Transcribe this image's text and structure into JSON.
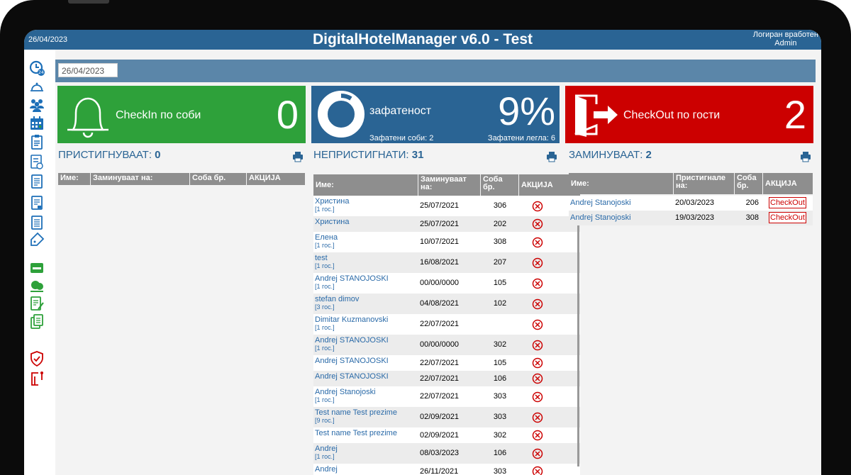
{
  "header": {
    "date": "26/04/2023",
    "title": "DigitalHotelManager v6.0 - Test",
    "user_line1": "Логиран вработен",
    "user_line2": "Admin"
  },
  "filter": {
    "date_value": "26/04/2023"
  },
  "tiles": {
    "checkin": {
      "label": "CheckIn по соби",
      "value": "0"
    },
    "occupancy": {
      "label": "зафатеност",
      "value": "9%",
      "rooms": "Зафатени соби: 2",
      "beds": "Зафатени легла: 6",
      "fraction": 0.09
    },
    "checkout": {
      "label": "CheckOut по гости",
      "value": "2"
    }
  },
  "arriving": {
    "title": "ПРИСТИГНУВААТ: ",
    "count": "0",
    "headers": [
      "Име:",
      "Заминуваат на:",
      "Соба бр.",
      "АКЦИЈА"
    ]
  },
  "not_arrived": {
    "title": "НЕПРИСТИГНАТИ: ",
    "count": "31",
    "headers": [
      "Име:",
      "Заминуваат на:",
      "Соба бр.",
      "АКЦИЈА"
    ],
    "rows": [
      {
        "name": "Христина",
        "guests": "[1 гос.]",
        "date": "25/07/2021",
        "room": "306"
      },
      {
        "name": "Христина",
        "guests": "",
        "date": "25/07/2021",
        "room": "202"
      },
      {
        "name": "Елена",
        "guests": "[1 гос.]",
        "date": "10/07/2021",
        "room": "308"
      },
      {
        "name": "test",
        "guests": "[1 гос.]",
        "date": "16/08/2021",
        "room": "207"
      },
      {
        "name": "Andrej STANOJOSKI",
        "guests": "[1 гос.]",
        "date": "00/00/0000",
        "room": "105"
      },
      {
        "name": "stefan dimov",
        "guests": "[3 гос.]",
        "date": "04/08/2021",
        "room": "102"
      },
      {
        "name": "Dimitar Kuzmanovski",
        "guests": "[1 гос.]",
        "date": "22/07/2021",
        "room": ""
      },
      {
        "name": "Andrej STANOJOSKI",
        "guests": "[1 гос.]",
        "date": "00/00/0000",
        "room": "302"
      },
      {
        "name": "Andrej STANOJOSKI",
        "guests": "",
        "date": "22/07/2021",
        "room": "105"
      },
      {
        "name": "Andrej STANOJOSKI",
        "guests": "",
        "date": "22/07/2021",
        "room": "106"
      },
      {
        "name": "Andrej Stanojoski",
        "guests": "[1 гос.]",
        "date": "22/07/2021",
        "room": "303"
      },
      {
        "name": "Test name Test prezime",
        "guests": "[9 гос.]",
        "date": "02/09/2021",
        "room": "303"
      },
      {
        "name": "Test name Test prezime",
        "guests": "",
        "date": "02/09/2021",
        "room": "302"
      },
      {
        "name": "Andrej",
        "guests": "[1 гос.]",
        "date": "08/03/2023",
        "room": "106"
      },
      {
        "name": "Andrej",
        "guests": "",
        "date": "26/11/2021",
        "room": "303"
      }
    ]
  },
  "departing": {
    "title": "ЗАМИНУВААТ: ",
    "count": "2",
    "headers": [
      "Име:",
      "Пристигнале на:",
      "Соба бр.",
      "АКЦИЈА"
    ],
    "rows": [
      {
        "name": "Andrej Stanojoski",
        "date": "20/03/2023",
        "room": "206",
        "action": "CheckOut"
      },
      {
        "name": "Andrej Stanojoski",
        "date": "19/03/2023",
        "room": "308",
        "action": "CheckOut"
      }
    ]
  },
  "colors": {
    "accent": "#2a6494",
    "green": "#2ea13a",
    "red": "#cc0000",
    "link": "#2a6aa8"
  }
}
